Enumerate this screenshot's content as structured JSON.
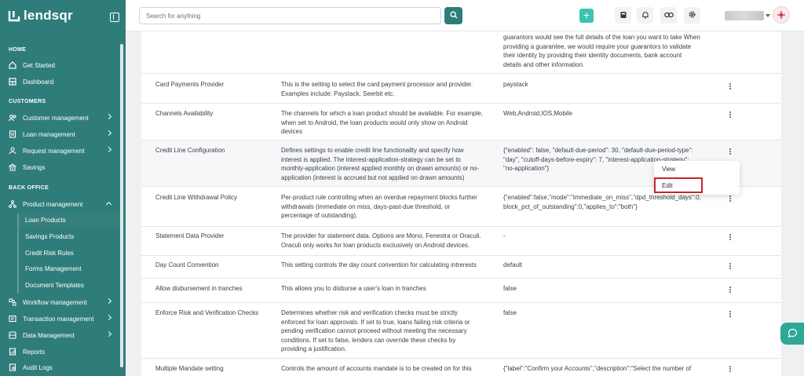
{
  "brand": {
    "name": "lendsqr"
  },
  "search": {
    "placeholder": "Search for anything"
  },
  "sidebar": {
    "sections": {
      "home": "HOME",
      "customers": "CUSTOMERS",
      "back_office": "BACK OFFICE"
    },
    "items": {
      "get_started": "Get Started",
      "dashboard": "Dashboard",
      "customer_management": "Customer management",
      "loan_management": "Loan management",
      "request_management": "Request management",
      "savings": "Savings",
      "product_management": "Product management",
      "workflow_management": "Workflow management",
      "transaction_management": "Transaction management",
      "data_management": "Data Management",
      "reports": "Reports",
      "audit_logs": "Audit Logs"
    },
    "sub_items": {
      "loan_products": "Loan Products",
      "savings_products": "Savings Products",
      "credit_risk_rules": "Credit Risk Rules",
      "forms_management": "Forms Management",
      "document_templates": "Document Templates"
    }
  },
  "settings": {
    "top_value_lines": [
      "guarantors would see the full details of the loan you want to take When",
      "providing a guarantee, we would require your guarantors to validate",
      "their identity by providing their identity documents, bank account",
      "details and other information."
    ],
    "rows": [
      {
        "name": "Card Payments Provider",
        "desc": [
          "This is the setting to select the card payment processor and provider.",
          "Examples include: Paystack, Seerbit etc."
        ],
        "value": [
          "paystack"
        ]
      },
      {
        "name": "Channels Availability",
        "desc": [
          "The channels for which a loan product should be available. For example,",
          "when set to Android, the loan products would only show on Android",
          "devices"
        ],
        "value": [
          "Web,Android,IOS,Mobile"
        ]
      },
      {
        "name": "Credit Line Configuration",
        "desc": [
          "Defines settings to enable credit line functionality and specify how",
          "interest is applied. The interest-application-strategy can be set to",
          "monthly-application (interest applied monthly on drawn amounts) or no-",
          "application (interest is accrued but not applied on drawn amounts)"
        ],
        "value": [
          "{\"enabled\": false, \"default-due-period\": 30, \"default-due-period-type\":",
          "\"day\", \"cutoff-days-before-expiry\": 7, \"interest-application-strategy\":",
          "\"no-application\"}"
        ]
      },
      {
        "name": "Credit Line Withdrawal Policy",
        "desc": [
          "Per-product rule controlling when an overdue repayment blocks further",
          "withdrawals (immediate on miss, days-past-due threshold, or",
          "percentage of outstanding)."
        ],
        "value": [
          "{\"enabled\":false,\"mode\":\"immediate_on_miss\",\"dpd_threshold_days\":0,",
          "block_pct_of_outstanding\":0,\"applies_to\":\"both\"}"
        ]
      },
      {
        "name": "Statement Data Provider",
        "desc": [
          "The provider for statement data. Options are Mono, Fenestra or Oraculi.",
          "Oraculi only works for loan products exclusively on Android devices."
        ],
        "value": [
          "-"
        ]
      },
      {
        "name": "Day Count Convention",
        "desc": [
          "This setting controls the day count convention for calculating intrerests"
        ],
        "value": [
          "default"
        ]
      },
      {
        "name": "Allow disbursement in tranches",
        "desc": [
          "This allows you to disburse a user's loan in tranches"
        ],
        "value": [
          "false"
        ]
      },
      {
        "name": "Enforce Risk and Verification Checks",
        "desc": [
          "Determines whether risk and verification checks must be strictly",
          "enforced for loan approvals. If set to true, loans failing risk criteria or",
          "pending verification cannot proceed without meeting the necessary",
          "conditions. If set to false, lenders can override these checks by",
          "providing a justification."
        ],
        "value": [
          "false"
        ]
      },
      {
        "name": "Multiple Mandate setting",
        "desc": [
          "Controls the amount of accounts mandate is to be created on for this"
        ],
        "value": [
          "{\"label\":\"Confirm your Accounts\",\"description\":\"Select the number of"
        ]
      }
    ]
  },
  "menu": {
    "view": "View",
    "edit": "Edit"
  },
  "icons": {
    "plus": "+",
    "accent": "#2f7d7a",
    "highlight": "#c8242b"
  }
}
